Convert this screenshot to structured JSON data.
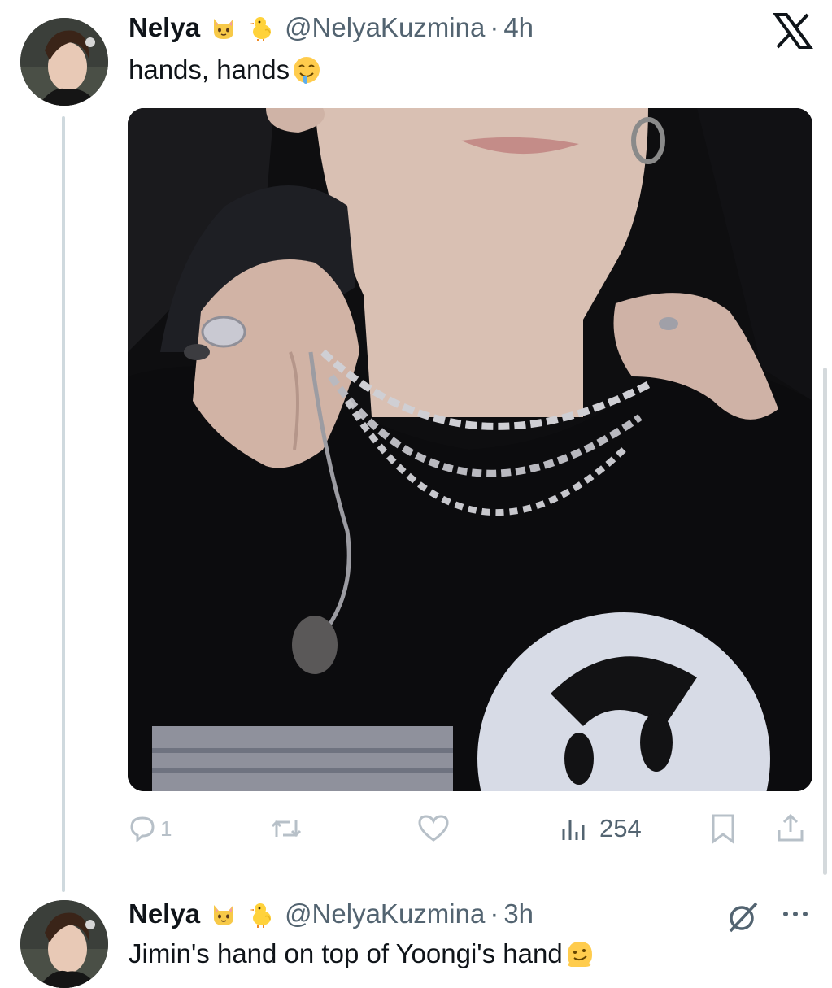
{
  "tweets": [
    {
      "display_name": "Nelya",
      "handle": "@NelyaKuzmina",
      "separator": "·",
      "time": "4h",
      "text": "hands, hands",
      "name_emojis": [
        "cat-face-emoji",
        "baby-chick-emoji"
      ],
      "text_emoji": "drooling-face-emoji",
      "actions": {
        "reply_count": "1",
        "retweet_count": "",
        "like_count": "",
        "views_count": "254"
      }
    },
    {
      "display_name": "Nelya",
      "handle": "@NelyaKuzmina",
      "separator": "·",
      "time": "3h",
      "text": "Jimin's hand on top of Yoongi's hand",
      "name_emojis": [
        "cat-face-emoji",
        "baby-chick-emoji"
      ],
      "text_emoji": "melting-face-emoji"
    }
  ],
  "icons": {
    "close": "x-logo-icon",
    "grok": "grok-icon",
    "more": "more-dots-icon"
  },
  "colors": {
    "text": "#0f1419",
    "secondary": "#536471",
    "action_icon": "#8b98a5",
    "thread_line": "#cfd9de"
  }
}
